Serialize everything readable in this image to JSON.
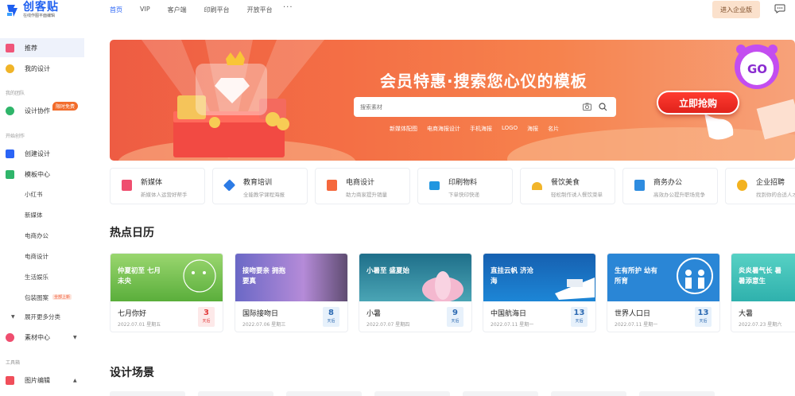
{
  "header": {
    "logo_name": "创客贴",
    "logo_sub": "在线作图平面编辑",
    "nav": [
      "首页",
      "VIP",
      "客户端",
      "印刷平台",
      "开放平台"
    ],
    "more": "···",
    "enter_label": "进入企业版"
  },
  "sidebar": {
    "items": [
      {
        "label": "推荐",
        "color": "#f0567a"
      },
      {
        "label": "我的设计",
        "color": "#f0b428"
      }
    ],
    "group_team": "我的团队",
    "design_collab": "设计协作",
    "design_collab_badge": "限时免费",
    "group_create": "开始创作",
    "create_design": "创建设计",
    "template_center": "模板中心",
    "template_subs": [
      "小红书",
      "新媒体",
      "电商办公",
      "电商设计",
      "生活娱乐",
      "包装图案"
    ],
    "template_sub_badge": "全部上新",
    "show_more": "展开更多分类",
    "material_center": "素材中心",
    "group_tools": "工具箱",
    "ai_tools": "图片编辑"
  },
  "banner": {
    "title": "会员特惠·搜索您心仪的模板",
    "search_placeholder": "搜索素材",
    "hot_words": [
      "新媒体配图",
      "电商海报设计",
      "手机海报",
      "LOGO",
      "海报",
      "名片"
    ],
    "cta": "立即抢购",
    "go_text": "GO"
  },
  "categories": [
    {
      "title": "新媒体",
      "sub": "新媒体人运营好帮手",
      "color": "#ef4e6f"
    },
    {
      "title": "教育培训",
      "sub": "全能教学课程海报",
      "color": "#2c7be5"
    },
    {
      "title": "电商设计",
      "sub": "助力商家提升销量",
      "color": "#f5683d"
    },
    {
      "title": "印刷物料",
      "sub": "下单快印快递",
      "color": "#2196e0"
    },
    {
      "title": "餐饮美食",
      "sub": "轻松制作诱人餐饮菜单",
      "color": "#f2b52a"
    },
    {
      "title": "商务办公",
      "sub": "高效办公提升职场竞争",
      "color": "#2e8ce0"
    },
    {
      "title": "企业招聘",
      "sub": "找到你的合适人才",
      "color": "#f3b21f"
    }
  ],
  "section_calendar": "热点日历",
  "section_scenes": "设计场景",
  "calendar": [
    {
      "img_text": "仲夏初至 七月未央",
      "name": "七月你好",
      "date": "2022.07.01 星期五",
      "days": "3",
      "unit": "天后",
      "tone": "red",
      "bg": "#8fcf6b"
    },
    {
      "img_text": "接吻要亲 拥抱要真",
      "name": "国际接吻日",
      "date": "2022.07.06 星期三",
      "days": "8",
      "unit": "天后",
      "tone": "blue",
      "bg": "#7c73c8"
    },
    {
      "img_text": "小暑至 盛夏始",
      "name": "小暑",
      "date": "2022.07.07 星期四",
      "days": "9",
      "unit": "天后",
      "tone": "blue",
      "bg": "#1f6f8a"
    },
    {
      "img_text": "直挂云帆 济沧海",
      "name": "中国航海日",
      "date": "2022.07.11 星期一",
      "days": "13",
      "unit": "天后",
      "tone": "blue",
      "bg": "#1d6fc0"
    },
    {
      "img_text": "生有所护 幼有所育",
      "name": "世界人口日",
      "date": "2022.07.11 星期一",
      "days": "13",
      "unit": "天后",
      "tone": "blue",
      "bg": "#2a86d6"
    },
    {
      "img_text": "炎炎暑气长 暑暑添意生",
      "name": "大暑",
      "date": "2022.07.23 星期六",
      "days": "",
      "unit": "",
      "tone": "blue",
      "bg": "#3fc2bd"
    }
  ]
}
